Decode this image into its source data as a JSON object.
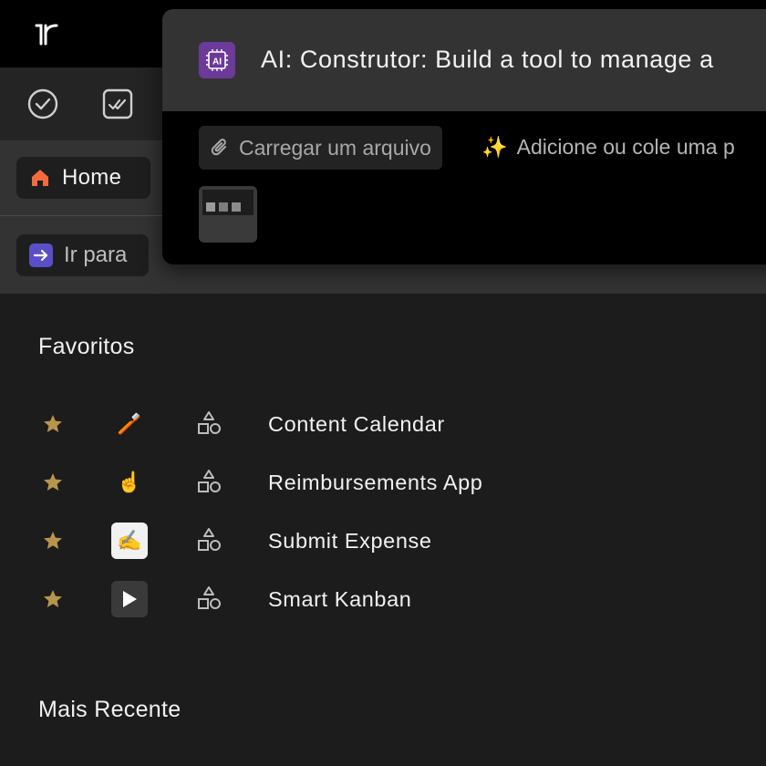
{
  "popup": {
    "title": "AI: Construtor: Build a tool to manage a",
    "badge": "AI",
    "upload_label": "Carregar um arquivo",
    "prompt_hint": "Adicione ou cole uma p",
    "sparkle": "✨"
  },
  "sidebar": {
    "home_label": "Home",
    "goto_label": "Ir para"
  },
  "favorites": {
    "title": "Favoritos",
    "items": [
      {
        "emoji": "🪥",
        "emoji_bg": "#1c1c1c",
        "name": "Content Calendar"
      },
      {
        "emoji": "☝️",
        "emoji_bg": "#1c1c1c",
        "name": "Reimbursements App"
      },
      {
        "emoji": "✍️",
        "emoji_bg": "#f1f1f1",
        "name": "Submit Expense"
      },
      {
        "emoji": "▶",
        "emoji_bg": "#3a3a3a",
        "name": "Smart Kanban"
      }
    ]
  },
  "recent": {
    "title": "Mais Recente"
  },
  "colors": {
    "star": "#b8954a",
    "home_icon": "#f26b3a",
    "goto_icon_bg": "#5a4ec9",
    "ai_badge": "#6c3a99"
  }
}
